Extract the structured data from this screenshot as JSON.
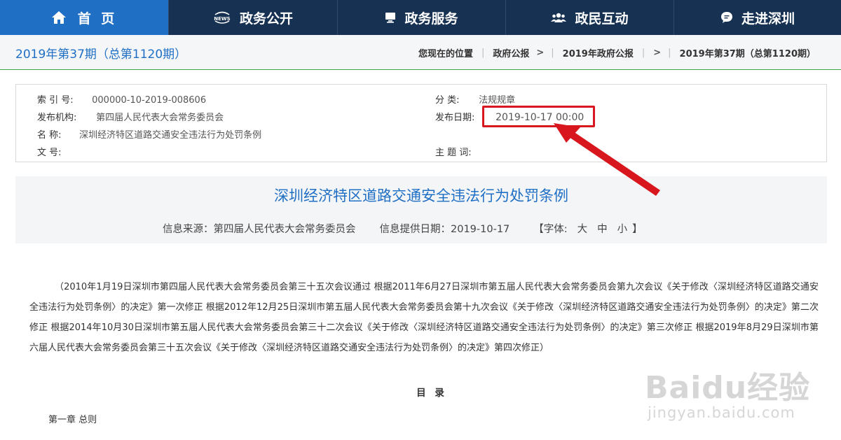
{
  "nav": {
    "items": [
      {
        "label": "首 页",
        "icon": "home-icon",
        "active": true
      },
      {
        "label": "政务公开",
        "icon": "news-icon",
        "active": false
      },
      {
        "label": "政务服务",
        "icon": "monitor-icon",
        "active": false
      },
      {
        "label": "政民互动",
        "icon": "users-icon",
        "active": false
      },
      {
        "label": "走进深圳",
        "icon": "chat-bubble-icon",
        "active": false
      }
    ],
    "news_icon_text": "NEWS"
  },
  "subheader": {
    "issue_title": "2019年第37期（总第1120期）",
    "breadcrumb": {
      "prefix": "您现在的位置",
      "items": [
        "政府公报",
        "2019年政府公报",
        "2019年第37期（总第1120期）"
      ],
      "separator": ">"
    }
  },
  "meta": {
    "index_key": "索 引 号:",
    "index_val": "000000-10-2019-008606",
    "publisher_key": "发布机构:",
    "publisher_val": "第四届人民代表大会常务委员会",
    "name_key": "名 称:",
    "name_val": "深圳经济特区道路交通安全违法行为处罚条例",
    "docno_key": "文 号:",
    "category_key": "分 类:",
    "category_val": "法规规章",
    "date_key": "发布日期:",
    "date_val": "2019-10-17 00:00",
    "subject_key": "主 题 词:"
  },
  "document": {
    "title": "深圳经济特区道路交通安全违法行为处罚条例",
    "source_label": "信息来源：第四届人民代表大会常务委员会",
    "provide_date_label": "信息提供日期：2019-10-17",
    "font_label_open": "【字体:",
    "font_large": "大",
    "font_medium": "中",
    "font_small": "小",
    "font_label_close": "】",
    "intro": "（2010年1月19日深圳市第四届人民代表大会常务委员会第三十五次会议通过 根据2011年6月27日深圳市第五届人民代表大会常务委员会第九次会议《关于修改〈深圳经济特区道路交通安全违法行为处罚条例〉的决定》第一次修正 根据2012年12月25日深圳市第五届人民代表大会常务委员会第十九次会议《关于修改〈深圳经济特区道路交通安全违法行为处罚条例〉的决定》第二次修正 根据2014年10月30日深圳市第五届人民代表大会常务委员会第三十二次会议《关于修改〈深圳经济特区道路交通安全违法行为处罚条例〉的决定》第三次修正 根据2019年8月29日深圳市第六届人民代表大会常务委员会第三十五次会议《关于修改〈深圳经济特区道路交通安全违法行为处罚条例〉的决定》第四次修正）",
    "toc_heading": "目 录",
    "chapter_1": "第一章 总则"
  },
  "watermark": {
    "main": "Baidu经验",
    "sub": "jingyan.baidu.com"
  },
  "colors": {
    "nav_bg": "#173152",
    "nav_active": "#1f6fc5",
    "accent_blue": "#1f6fc5",
    "highlight_red": "#d8161d",
    "divider_green": "#3aa34a"
  }
}
